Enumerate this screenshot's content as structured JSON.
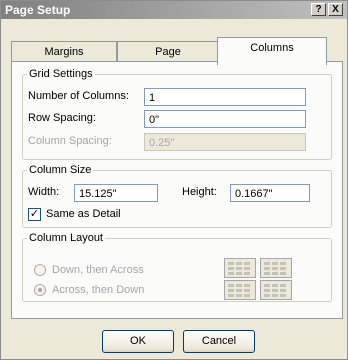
{
  "window": {
    "title": "Page Setup",
    "help_glyph": "?",
    "close_glyph": "X"
  },
  "tabs": [
    {
      "label": "Margins"
    },
    {
      "label": "Page"
    },
    {
      "label": "Columns"
    }
  ],
  "grid_settings": {
    "legend": "Grid Settings",
    "num_columns_label": "Number of Columns:",
    "num_columns_value": "1",
    "row_spacing_label": "Row Spacing:",
    "row_spacing_value": "0\"",
    "column_spacing_label": "Column Spacing:",
    "column_spacing_value": "0.25\""
  },
  "column_size": {
    "legend": "Column Size",
    "width_label": "Width:",
    "width_value": "15.125\"",
    "height_label": "Height:",
    "height_value": "0.1667\"",
    "same_as_detail_label": "Same as Detail",
    "same_as_detail_checked": true,
    "check_glyph": "✓"
  },
  "column_layout": {
    "legend": "Column Layout",
    "down_then_across_label": "Down, then Across",
    "across_then_down_label": "Across, then Down",
    "selected": "across_then_down"
  },
  "buttons": {
    "ok_label": "OK",
    "cancel_label": "Cancel"
  },
  "colors": {
    "dialog_bg": "#ece9d8",
    "panel_bg": "#fbfbf9",
    "disabled_text": "#a7a6aa"
  }
}
